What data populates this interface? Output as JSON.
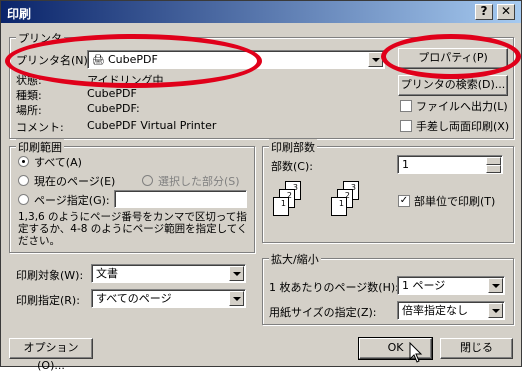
{
  "window": {
    "title": "印刷",
    "help_button": "?",
    "close_button": "✕"
  },
  "printer": {
    "group_label": "プリンタ",
    "name_label": "プリンタ名(N):",
    "name_value": "CubePDF",
    "status_label": "状態:",
    "status_value": "アイドリング中",
    "type_label": "種類:",
    "type_value": "CubePDF",
    "location_label": "場所:",
    "location_value": "CubePDF:",
    "comment_label": "コメント:",
    "comment_value": "CubePDF Virtual Printer",
    "properties_button": "プロパティ(P)",
    "find_button": "プリンタの検索(D)...",
    "print_to_file_label": "ファイルへ出力(L)",
    "print_to_file_checked": false,
    "manual_duplex_label": "手差し両面印刷(X)",
    "manual_duplex_checked": false
  },
  "page_range": {
    "group_label": "印刷範囲",
    "all_label": "すべて(A)",
    "current_label": "現在のページ(E)",
    "selection_label": "選択した部分(S)",
    "pages_label": "ページ指定(G):",
    "pages_value": "",
    "selected": "all",
    "help_text": "1,3,6 のようにページ番号をカンマで区切って指定するか、4-8 のようにページ範囲を指定してください。"
  },
  "copies": {
    "group_label": "印刷部数",
    "count_label": "部数(C):",
    "count_value": "1",
    "collate_label": "部単位で印刷(T)",
    "collate_checked": true,
    "collate_page_numbers": [
      "1",
      "2",
      "3"
    ]
  },
  "print_what": {
    "label": "印刷対象(W):",
    "value": "文書"
  },
  "print_spec": {
    "label": "印刷指定(R):",
    "value": "すべてのページ"
  },
  "zoom": {
    "group_label": "拡大/縮小",
    "pages_per_sheet_label": "1 枚あたりのページ数(H):",
    "pages_per_sheet_value": "1 ページ",
    "scale_label": "用紙サイズの指定(Z):",
    "scale_value": "倍率指定なし"
  },
  "footer": {
    "options_button": "オプション(O)...",
    "ok_button": "OK",
    "close_button": "閉じる"
  },
  "colors": {
    "highlight_oval": "#e0001a",
    "titlebar": "#0a246a"
  }
}
